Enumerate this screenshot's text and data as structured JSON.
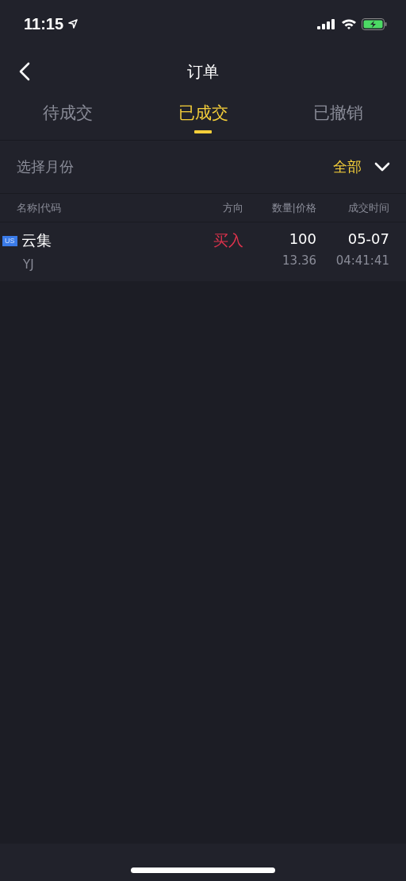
{
  "status_bar": {
    "time": "11:15"
  },
  "nav": {
    "title": "订单"
  },
  "tabs": [
    {
      "label": "待成交",
      "selected": false
    },
    {
      "label": "已成交",
      "selected": true
    },
    {
      "label": "已撤销",
      "selected": false
    }
  ],
  "month_filter": {
    "label": "选择月份",
    "value": "全部"
  },
  "table": {
    "columns": [
      "名称|代码",
      "方向",
      "数量|价格",
      "成交时间"
    ],
    "rows": [
      {
        "market": "US",
        "name": "云集",
        "code": "YJ",
        "direction": "买入",
        "color": "#e0334d",
        "quantity": "100",
        "price": "13.36",
        "date": "05-07",
        "time": "04:41:41"
      }
    ]
  }
}
